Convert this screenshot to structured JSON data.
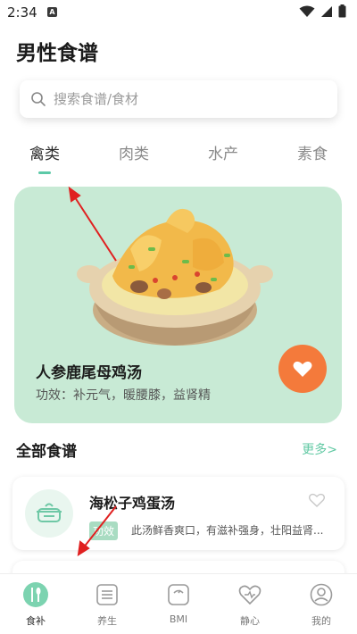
{
  "status_bar": {
    "time": "2:34",
    "notification_letter": "A"
  },
  "page": {
    "title": "男性食谱"
  },
  "search": {
    "placeholder": "搜索食谱/食材"
  },
  "tabs": [
    {
      "label": "禽类",
      "active": true
    },
    {
      "label": "肉类",
      "active": false
    },
    {
      "label": "水产",
      "active": false
    },
    {
      "label": "素食",
      "active": false
    }
  ],
  "featured": {
    "title": "人参鹿尾母鸡汤",
    "desc": "功效：补元气，暖腰膝，益肾精"
  },
  "section": {
    "title": "全部食谱",
    "more": "更多>"
  },
  "recipes": [
    {
      "name": "海松子鸡蛋汤",
      "tag": "功效",
      "desc": "此汤鲜香爽口，有滋补强身，壮阳益肾..."
    }
  ],
  "bottom_nav": [
    {
      "label": "食补",
      "icon": "food-icon",
      "active": true
    },
    {
      "label": "养生",
      "icon": "list-icon",
      "active": false
    },
    {
      "label": "BMI",
      "icon": "scale-icon",
      "active": false
    },
    {
      "label": "静心",
      "icon": "heart-icon",
      "active": false
    },
    {
      "label": "我的",
      "icon": "profile-icon",
      "active": false
    }
  ],
  "colors": {
    "accent": "#5cc9a7",
    "card_bg": "#c8ead5",
    "fav_button": "#f47a3b",
    "annotation_arrow": "#e02020"
  }
}
